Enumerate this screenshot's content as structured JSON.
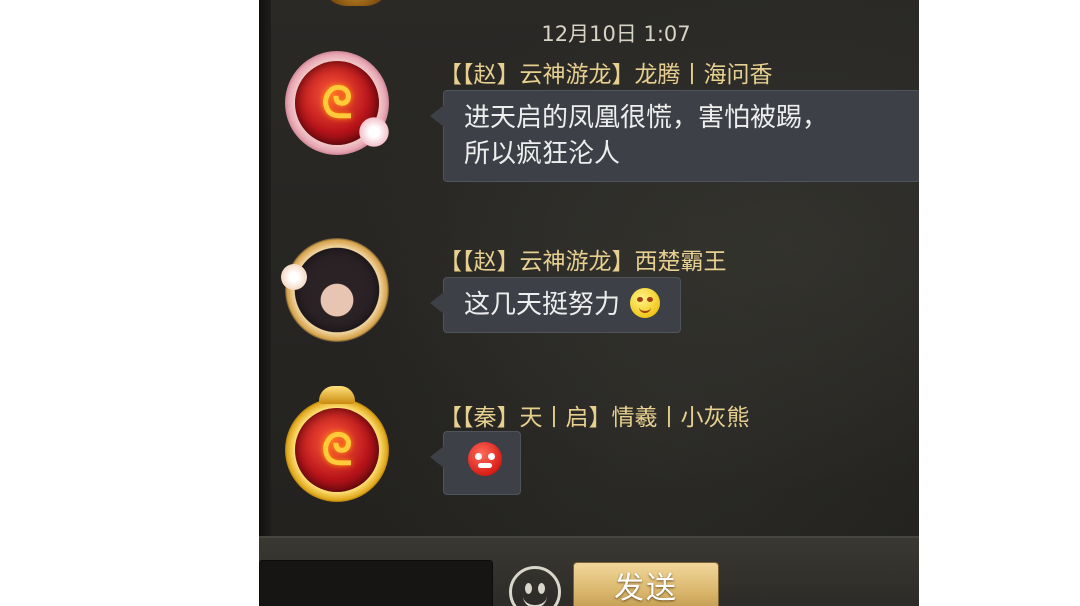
{
  "chat": {
    "timestamp": "12月10日 1:07",
    "messages": [
      {
        "sender": "【【赵】云神游龙】龙腾丨海问香",
        "avatar_glyph": "ᘓ",
        "lines": [
          "进天启的凤凰很慌，害怕被踢，",
          "所以疯狂沦人"
        ]
      },
      {
        "sender": "【【赵】云神游龙】西楚霸王",
        "text": "这几天挺努力"
      },
      {
        "sender": "【【秦】天丨启】情羲丨小灰熊",
        "avatar_glyph": "ᘓ"
      }
    ]
  },
  "input_bar": {
    "message_value": "",
    "send_label": "发送"
  },
  "colors": {
    "panel_bg": "#262522",
    "sender_name": "#e6cf8f",
    "bubble_bg": "#3d4147",
    "send_button": "#d8b56a"
  },
  "icons": [
    "emoji-smile-icon",
    "emoji-angry-icon",
    "emoji-picker-icon",
    "avatar-frame-icon"
  ]
}
